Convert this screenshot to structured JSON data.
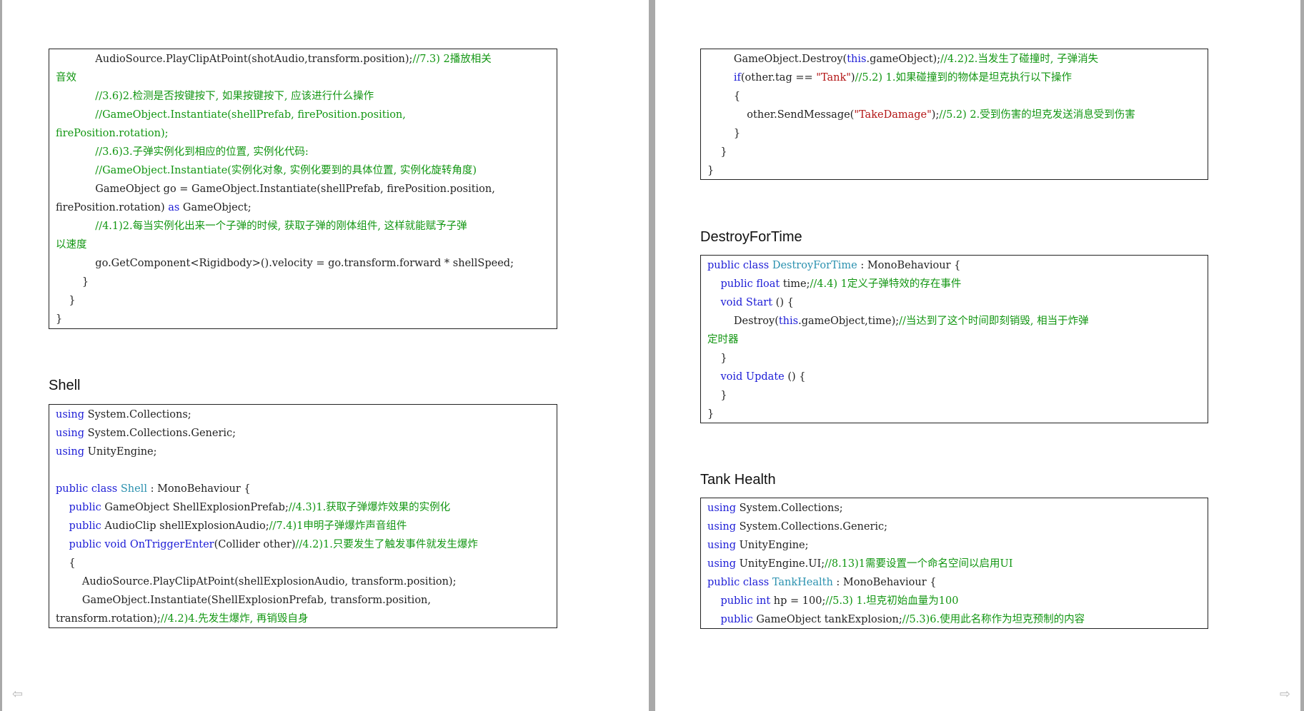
{
  "colors": {
    "keyword": "#1c1cd6",
    "type": "#2b91af",
    "comment": "#129612",
    "string": "#b31515",
    "text": "#222222",
    "background": "#a9a9a9",
    "page": "#ffffff"
  },
  "left_page": {
    "code_box_top": {
      "lines": [
        [
          {
            "t": "            AudioSource.PlayClipAtPoint(shotAudio,transform.position);",
            "c": "txt"
          },
          {
            "t": "//7.3) 2播放相关",
            "c": "com"
          }
        ],
        [
          {
            "t": "音效",
            "c": "com"
          }
        ],
        [
          {
            "t": "            //3.6)2.检测是否按键按下, 如果按键按下, 应该进行什么操作",
            "c": "com"
          }
        ],
        [
          {
            "t": "            //GameObject.Instantiate(shellPrefab, firePosition.position,",
            "c": "com"
          }
        ],
        [
          {
            "t": "firePosition.rotation);",
            "c": "com"
          }
        ],
        [
          {
            "t": "            //3.6)3.子弹实例化到相应的位置, 实例化代码:",
            "c": "com"
          }
        ],
        [
          {
            "t": "            //GameObject.Instantiate(实例化对象, 实例化要到的具体位置, 实例化旋转角度)",
            "c": "com"
          }
        ],
        [
          {
            "t": "            GameObject go = GameObject.Instantiate(shellPrefab, firePosition.position,",
            "c": "txt"
          }
        ],
        [
          {
            "t": "firePosition.rotation) ",
            "c": "txt"
          },
          {
            "t": "as",
            "c": "kw"
          },
          {
            "t": " GameObject;",
            "c": "txt"
          }
        ],
        [
          {
            "t": "            //4.1)2.每当实例化出来一个子弹的时候, 获取子弹的刚体组件, 这样就能赋予子弹",
            "c": "com"
          }
        ],
        [
          {
            "t": "以速度",
            "c": "com"
          }
        ],
        [
          {
            "t": "            go.GetComponent<Rigidbody>().velocity = go.transform.forward * shellSpeed;",
            "c": "txt"
          }
        ],
        [
          {
            "t": "        }",
            "c": "txt"
          }
        ],
        [
          {
            "t": "    }",
            "c": "txt"
          }
        ],
        [
          {
            "t": "}",
            "c": "txt"
          }
        ]
      ]
    },
    "shell_heading": "Shell",
    "shell_code": {
      "lines": [
        [
          {
            "t": "using",
            "c": "kw"
          },
          {
            "t": " System.Collections;",
            "c": "txt"
          }
        ],
        [
          {
            "t": "using",
            "c": "kw"
          },
          {
            "t": " System.Collections.Generic;",
            "c": "txt"
          }
        ],
        [
          {
            "t": "using",
            "c": "kw"
          },
          {
            "t": " UnityEngine;",
            "c": "txt"
          }
        ],
        [
          {
            "t": "",
            "c": "txt"
          }
        ],
        [
          {
            "t": "public",
            "c": "kw"
          },
          {
            "t": " ",
            "c": "txt"
          },
          {
            "t": "class",
            "c": "kw"
          },
          {
            "t": " ",
            "c": "txt"
          },
          {
            "t": "Shell",
            "c": "typ"
          },
          {
            "t": " : MonoBehaviour {",
            "c": "txt"
          }
        ],
        [
          {
            "t": "    ",
            "c": "txt"
          },
          {
            "t": "public",
            "c": "kw"
          },
          {
            "t": " GameObject ShellExplosionPrefab;",
            "c": "txt"
          },
          {
            "t": "//4.3)1.获取子弹爆炸效果的实例化",
            "c": "com"
          }
        ],
        [
          {
            "t": "    ",
            "c": "txt"
          },
          {
            "t": "public",
            "c": "kw"
          },
          {
            "t": " AudioClip shellExplosionAudio;",
            "c": "txt"
          },
          {
            "t": "//7.4)1申明子弹爆炸声音组件",
            "c": "com"
          }
        ],
        [
          {
            "t": "    ",
            "c": "txt"
          },
          {
            "t": "public",
            "c": "kw"
          },
          {
            "t": " ",
            "c": "txt"
          },
          {
            "t": "void",
            "c": "kw"
          },
          {
            "t": " ",
            "c": "txt"
          },
          {
            "t": "OnTriggerEnter",
            "c": "kw"
          },
          {
            "t": "(Collider other)",
            "c": "txt"
          },
          {
            "t": "//4.2)1.只要发生了触发事件就发生爆炸",
            "c": "com"
          }
        ],
        [
          {
            "t": "    {",
            "c": "txt"
          }
        ],
        [
          {
            "t": "        AudioSource.PlayClipAtPoint(shellExplosionAudio, transform.position);",
            "c": "txt"
          }
        ],
        [
          {
            "t": "        GameObject.Instantiate(ShellExplosionPrefab, transform.position,",
            "c": "txt"
          }
        ],
        [
          {
            "t": "transform.rotation);",
            "c": "txt"
          },
          {
            "t": "//4.2)4.先发生爆炸, 再销毁自身",
            "c": "com"
          }
        ]
      ]
    }
  },
  "right_page": {
    "code_box_top": {
      "lines": [
        [
          {
            "t": "        GameObject.Destroy(",
            "c": "txt"
          },
          {
            "t": "this",
            "c": "kw"
          },
          {
            "t": ".gameObject);",
            "c": "txt"
          },
          {
            "t": "//4.2)2.当发生了碰撞时, 子弹消失",
            "c": "com"
          }
        ],
        [
          {
            "t": "        ",
            "c": "txt"
          },
          {
            "t": "if",
            "c": "kw"
          },
          {
            "t": "(other.tag == ",
            "c": "txt"
          },
          {
            "t": "\"Tank\"",
            "c": "str"
          },
          {
            "t": ")",
            "c": "txt"
          },
          {
            "t": "//5.2) 1.如果碰撞到的物体是坦克执行以下操作",
            "c": "com"
          }
        ],
        [
          {
            "t": "        {",
            "c": "txt"
          }
        ],
        [
          {
            "t": "            other.SendMessage(",
            "c": "txt"
          },
          {
            "t": "\"TakeDamage\"",
            "c": "str"
          },
          {
            "t": ");",
            "c": "txt"
          },
          {
            "t": "//5.2) 2.受到伤害的坦克发送消息受到伤害",
            "c": "com"
          }
        ],
        [
          {
            "t": "        }",
            "c": "txt"
          }
        ],
        [
          {
            "t": "    }",
            "c": "txt"
          }
        ],
        [
          {
            "t": "}",
            "c": "txt"
          }
        ]
      ]
    },
    "destroy_heading": "DestroyForTime",
    "destroy_code": {
      "lines": [
        [
          {
            "t": "public",
            "c": "kw"
          },
          {
            "t": " ",
            "c": "txt"
          },
          {
            "t": "class",
            "c": "kw"
          },
          {
            "t": " ",
            "c": "txt"
          },
          {
            "t": "DestroyForTime",
            "c": "typ"
          },
          {
            "t": " : MonoBehaviour {",
            "c": "txt"
          }
        ],
        [
          {
            "t": "    ",
            "c": "txt"
          },
          {
            "t": "public",
            "c": "kw"
          },
          {
            "t": " ",
            "c": "txt"
          },
          {
            "t": "float",
            "c": "kw"
          },
          {
            "t": " time;",
            "c": "txt"
          },
          {
            "t": "//4.4) 1定义子弹特效的存在事件",
            "c": "com"
          }
        ],
        [
          {
            "t": "    ",
            "c": "txt"
          },
          {
            "t": "void",
            "c": "kw"
          },
          {
            "t": " ",
            "c": "txt"
          },
          {
            "t": "Start",
            "c": "kw"
          },
          {
            "t": " () {",
            "c": "txt"
          }
        ],
        [
          {
            "t": "        Destroy(",
            "c": "txt"
          },
          {
            "t": "this",
            "c": "kw"
          },
          {
            "t": ".gameObject,time);",
            "c": "txt"
          },
          {
            "t": "//当达到了这个时间即刻销毁, 相当于炸弹",
            "c": "com"
          }
        ],
        [
          {
            "t": "定时器",
            "c": "com"
          }
        ],
        [
          {
            "t": "    }",
            "c": "txt"
          }
        ],
        [
          {
            "t": "    ",
            "c": "txt"
          },
          {
            "t": "void",
            "c": "kw"
          },
          {
            "t": " ",
            "c": "txt"
          },
          {
            "t": "Update",
            "c": "kw"
          },
          {
            "t": " () {",
            "c": "txt"
          }
        ],
        [
          {
            "t": "    }",
            "c": "txt"
          }
        ],
        [
          {
            "t": "}",
            "c": "txt"
          }
        ]
      ]
    },
    "tank_heading": "Tank Health",
    "tank_code": {
      "lines": [
        [
          {
            "t": "using",
            "c": "kw"
          },
          {
            "t": " System.Collections;",
            "c": "txt"
          }
        ],
        [
          {
            "t": "using",
            "c": "kw"
          },
          {
            "t": " System.Collections.Generic;",
            "c": "txt"
          }
        ],
        [
          {
            "t": "using",
            "c": "kw"
          },
          {
            "t": " UnityEngine;",
            "c": "txt"
          }
        ],
        [
          {
            "t": "using",
            "c": "kw"
          },
          {
            "t": " UnityEngine.UI;",
            "c": "txt"
          },
          {
            "t": "//8.13)1需要设置一个命名空间以启用UI",
            "c": "com"
          }
        ],
        [
          {
            "t": "public",
            "c": "kw"
          },
          {
            "t": " ",
            "c": "txt"
          },
          {
            "t": "class",
            "c": "kw"
          },
          {
            "t": " ",
            "c": "txt"
          },
          {
            "t": "TankHealth",
            "c": "typ"
          },
          {
            "t": " : MonoBehaviour {",
            "c": "txt"
          }
        ],
        [
          {
            "t": "    ",
            "c": "txt"
          },
          {
            "t": "public",
            "c": "kw"
          },
          {
            "t": " ",
            "c": "txt"
          },
          {
            "t": "int",
            "c": "kw"
          },
          {
            "t": " hp = 100;",
            "c": "txt"
          },
          {
            "t": "//5.3) 1.坦克初始血量为100",
            "c": "com"
          }
        ],
        [
          {
            "t": "    ",
            "c": "txt"
          },
          {
            "t": "public",
            "c": "kw"
          },
          {
            "t": " GameObject tankExplosion;",
            "c": "txt"
          },
          {
            "t": "//5.3)6.使用此名称作为坦克预制的内容",
            "c": "com"
          }
        ]
      ]
    }
  },
  "nav": {
    "left_arrow": "⇦",
    "right_arrow": "⇨"
  }
}
